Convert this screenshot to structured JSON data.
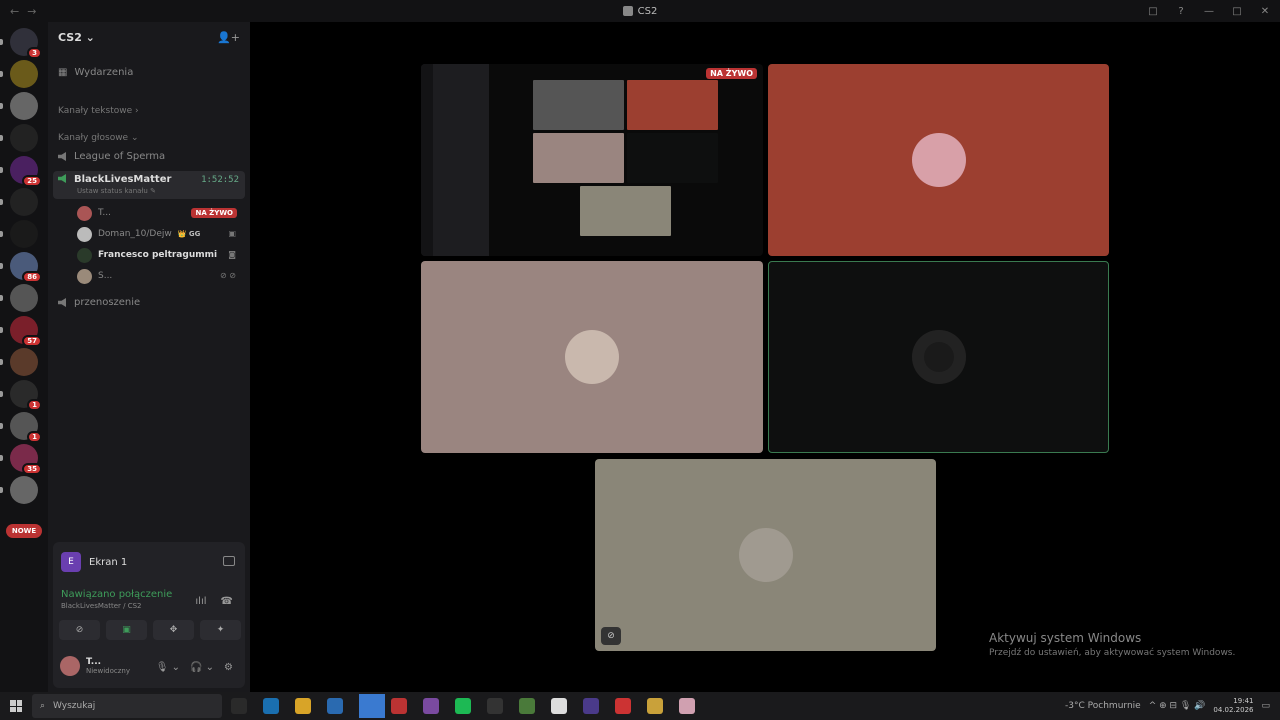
{
  "window": {
    "title": "CS2",
    "nav_back": "←",
    "nav_forward": "→",
    "inbox_icon": "□",
    "help_icon": "?",
    "min": "—",
    "max": "□",
    "close": "✕"
  },
  "guilds": [
    {
      "color": "#30303a",
      "badge": "3",
      "icon": "discord-logo-icon"
    },
    {
      "color": "#6a5a1a",
      "badge": ""
    },
    {
      "color": "#666",
      "badge": ""
    },
    {
      "color": "#222",
      "badge": ""
    },
    {
      "color": "#4a2060",
      "badge": "25"
    },
    {
      "color": "#222",
      "badge": ""
    },
    {
      "color": "#1a1a1a",
      "badge": ""
    },
    {
      "color": "#4a5a7a",
      "badge": "86"
    },
    {
      "color": "#555",
      "badge": ""
    },
    {
      "color": "#7a1f2a",
      "badge": "57"
    },
    {
      "color": "#5a3a2a",
      "badge": ""
    },
    {
      "color": "#2a2a2a",
      "badge": "1"
    },
    {
      "color": "#555",
      "badge": "1"
    },
    {
      "color": "#7a2a4a",
      "badge": "35"
    },
    {
      "color": "#666",
      "badge": ""
    }
  ],
  "new_label": "NOWE",
  "server": {
    "name": "CS2 ⌄",
    "add_member_icon": "add-member-icon"
  },
  "events_label": "Wydarzenia",
  "categories": {
    "text": "Kanały tekstowe ›",
    "voice": "Kanały głosowe ⌄"
  },
  "voice_channels": {
    "ch1": "League of Sperma",
    "active": {
      "name": "BlackLivesMatter",
      "timer": "1:52:52",
      "status": "Ustaw status kanału ✎"
    },
    "ch3": "przenoszenie"
  },
  "members": [
    {
      "name": "T...",
      "live": "NA ŻYWO",
      "bold": false,
      "color": "#a55"
    },
    {
      "name": "Doman_10/Dejw",
      "tag": "👑 GG",
      "bold": false,
      "color": "#bbb",
      "icon": "▣"
    },
    {
      "name": "Francesco peltragummi",
      "bold": true,
      "color": "#2a3a2a",
      "icon": "◙"
    },
    {
      "name": "S...",
      "bold": false,
      "color": "#9a8a7a",
      "icon": "⊘ ⊘"
    }
  ],
  "panel": {
    "screen": {
      "initial": "E",
      "label": "Ekran 1"
    },
    "conn": {
      "status": "Nawiązano połączenie",
      "sub": "BlackLivesMatter / CS2",
      "wave": "ılıl",
      "hangup": "☎"
    },
    "buttons": [
      "⊘",
      "▣",
      "✥",
      "✦"
    ],
    "user": {
      "name": "T...",
      "status": "Niewidoczny",
      "mic": "🎙 ⌄",
      "headset": "🎧 ⌄",
      "settings": "⚙"
    }
  },
  "tiles": {
    "live": "NA ŻYWO",
    "colors": {
      "stream_bg": "#0a0a0a",
      "t2": "#9c3f30",
      "t3": "#9a8580",
      "t4": "#0e0f0f",
      "t5": "#8a8678",
      "t4_border": "#3a7a50"
    },
    "mute_icon": "⊘"
  },
  "watermark": {
    "line1": "Aktywuj system Windows",
    "line2": "Przejdź do ustawień, aby aktywować system Windows."
  },
  "taskbar": {
    "search": "Wyszukaj",
    "weather": "-3°C  Pochmurnie",
    "time": "19:41",
    "date": "04.02.2026",
    "apps": [
      "#2a2a2a",
      "#1a6fb0",
      "#d8a428",
      "#2a6ab0",
      "#3a7ad0",
      "#b33",
      "#7a4aa0",
      "#1db954",
      "#333",
      "#4a7a3a",
      "#ddd",
      "#4a3a8a",
      "#c33",
      "#c9a13a",
      "#d0a0b0"
    ],
    "tray_icons": "^  ⊕  ⊟  🎙  🔊"
  }
}
